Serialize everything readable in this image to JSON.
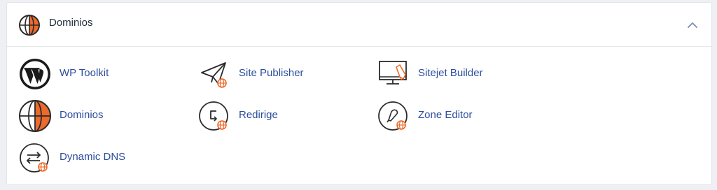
{
  "section": {
    "title": "Dominios"
  },
  "items": [
    {
      "label": "WP Toolkit",
      "icon": "wordpress-icon"
    },
    {
      "label": "Site Publisher",
      "icon": "paper-plane-icon"
    },
    {
      "label": "Sitejet Builder",
      "icon": "monitor-pen-icon"
    },
    {
      "label": "Dominios",
      "icon": "globe-icon"
    },
    {
      "label": "Redirige",
      "icon": "redirect-icon"
    },
    {
      "label": "Zone Editor",
      "icon": "zone-editor-icon"
    },
    {
      "label": "Dynamic DNS",
      "icon": "dynamic-dns-icon"
    }
  ],
  "colors": {
    "accent_orange": "#ec6a2c",
    "link_blue": "#2b4d9c",
    "icon_dark": "#2a2a2a"
  }
}
